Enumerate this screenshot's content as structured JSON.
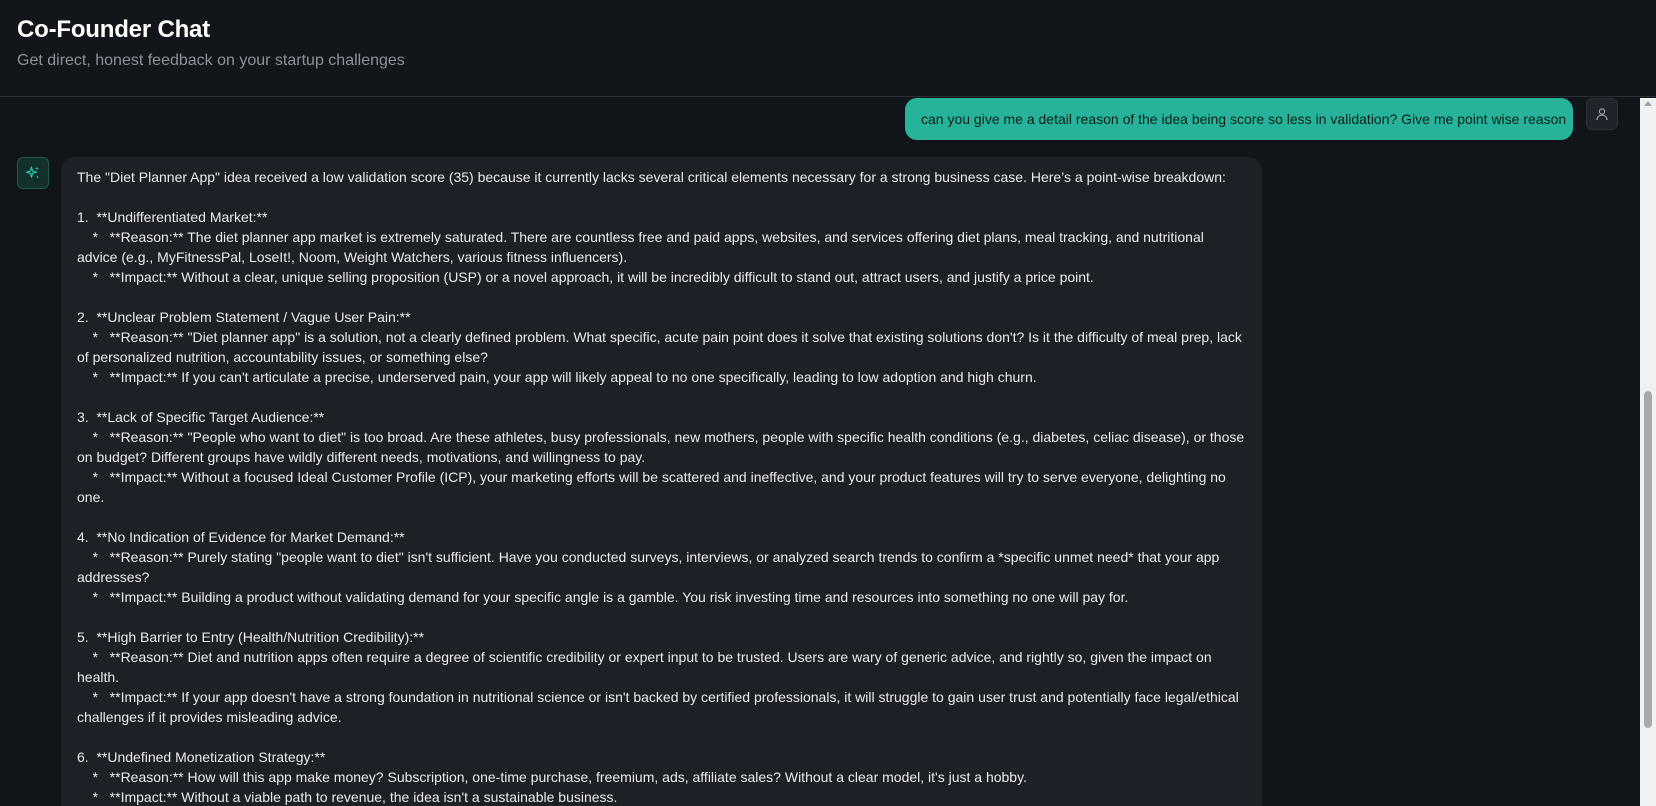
{
  "header": {
    "title": "Co-Founder Chat",
    "subtitle": "Get direct, honest feedback on your startup challenges"
  },
  "user_message": {
    "text": "can you give me a detail reason of the idea being score so less in validation? Give me point wise reason",
    "avatar_icon": "user-icon"
  },
  "assistant_message": {
    "avatar_icon": "sparkle-icon",
    "lines": [
      "The \"Diet Planner App\" idea received a low validation score (35) because it currently lacks several critical elements necessary for a strong business case. Here’s a point-wise breakdown:",
      "",
      "1.  **Undifferentiated Market:**",
      "    *   **Reason:** The diet planner app market is extremely saturated. There are countless free and paid apps, websites, and services offering diet plans, meal tracking, and nutritional advice (e.g., MyFitnessPal, LoseIt!, Noom, Weight Watchers, various fitness influencers).",
      "    *   **Impact:** Without a clear, unique selling proposition (USP) or a novel approach, it will be incredibly difficult to stand out, attract users, and justify a price point.",
      "",
      "2.  **Unclear Problem Statement / Vague User Pain:**",
      "    *   **Reason:** \"Diet planner app\" is a solution, not a clearly defined problem. What specific, acute pain point does it solve that existing solutions don't? Is it the difficulty of meal prep, lack of personalized nutrition, accountability issues, or something else?",
      "    *   **Impact:** If you can't articulate a precise, underserved pain, your app will likely appeal to no one specifically, leading to low adoption and high churn.",
      "",
      "3.  **Lack of Specific Target Audience:**",
      "    *   **Reason:** \"People who want to diet\" is too broad. Are these athletes, busy professionals, new mothers, people with specific health conditions (e.g., diabetes, celiac disease), or those on budget? Different groups have wildly different needs, motivations, and willingness to pay.",
      "    *   **Impact:** Without a focused Ideal Customer Profile (ICP), your marketing efforts will be scattered and ineffective, and your product features will try to serve everyone, delighting no one.",
      "",
      "4.  **No Indication of Evidence for Market Demand:**",
      "    *   **Reason:** Purely stating \"people want to diet\" isn't sufficient. Have you conducted surveys, interviews, or analyzed search trends to confirm a *specific unmet need* that your app addresses?",
      "    *   **Impact:** Building a product without validating demand for your specific angle is a gamble. You risk investing time and resources into something no one will pay for.",
      "",
      "5.  **High Barrier to Entry (Health/Nutrition Credibility):**",
      "    *   **Reason:** Diet and nutrition apps often require a degree of scientific credibility or expert input to be trusted. Users are wary of generic advice, and rightly so, given the impact on health.",
      "    *   **Impact:** If your app doesn't have a strong foundation in nutritional science or isn't backed by certified professionals, it will struggle to gain user trust and potentially face legal/ethical challenges if it provides misleading advice.",
      "",
      "6.  **Undefined Monetization Strategy:**",
      "    *   **Reason:** How will this app make money? Subscription, one-time purchase, freemium, ads, affiliate sales? Without a clear model, it's just a hobby.",
      "    *   **Impact:** Without a viable path to revenue, the idea isn't a sustainable business."
    ]
  }
}
